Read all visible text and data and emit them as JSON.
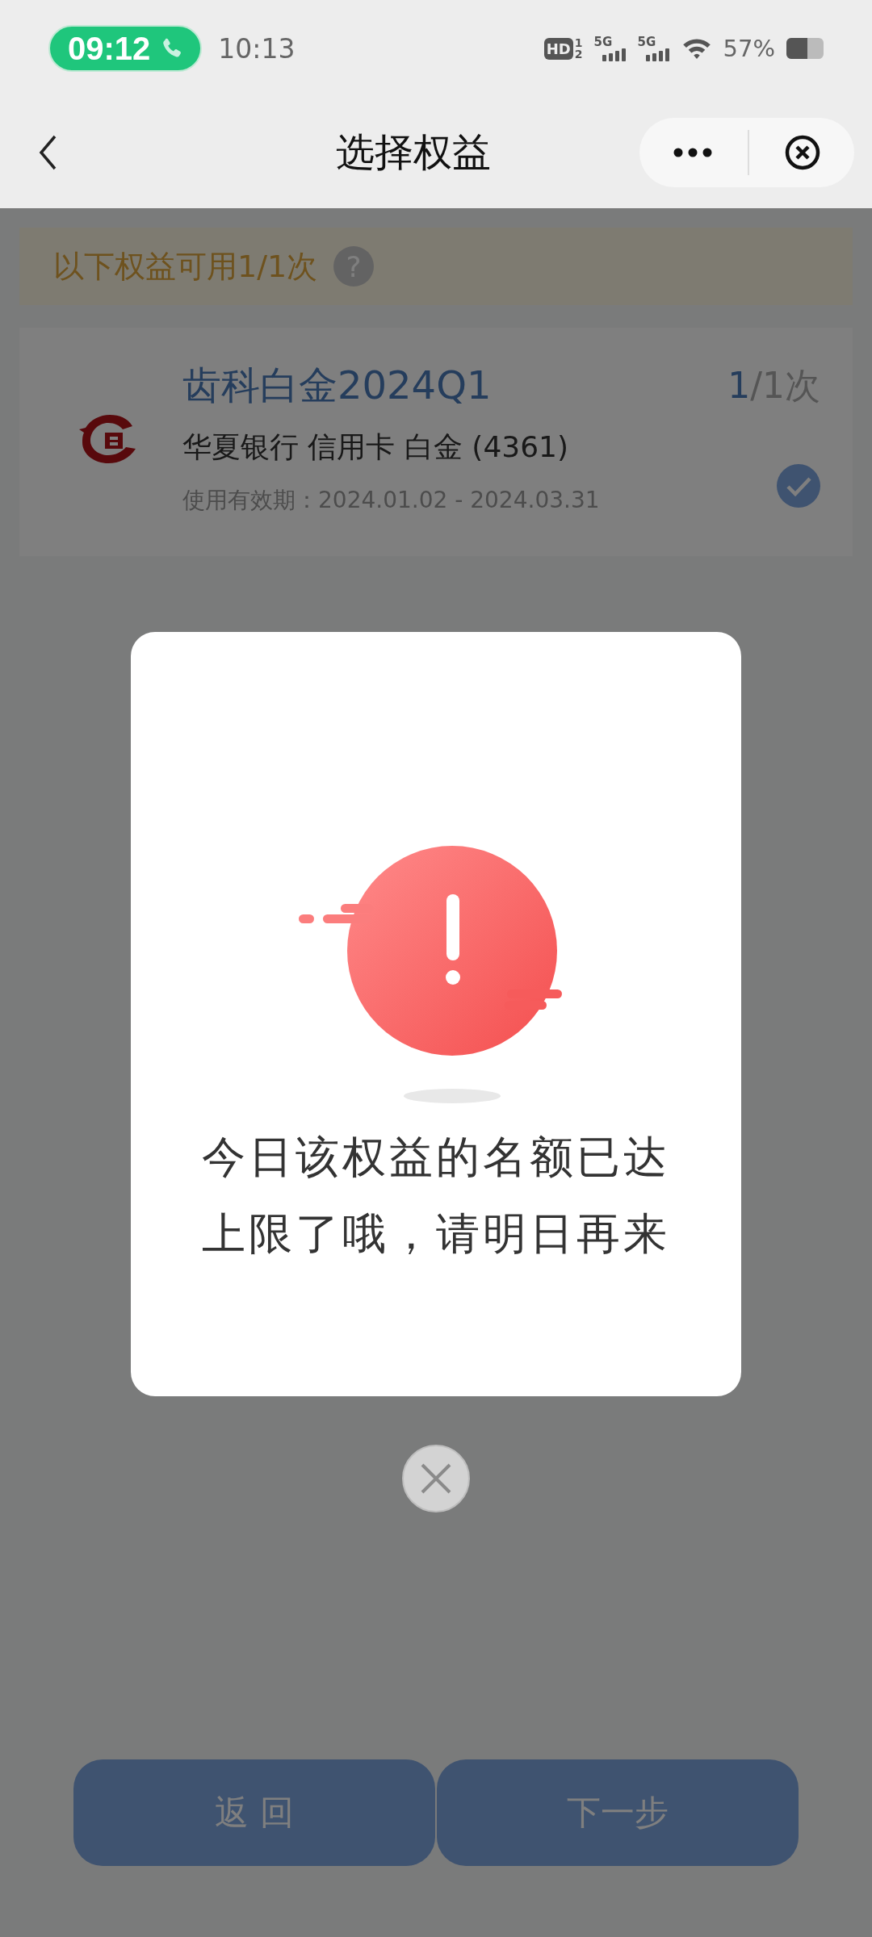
{
  "status_bar": {
    "call_time": "09:12",
    "time": "10:13",
    "hd": "HD",
    "hd_slots": [
      "1",
      "2"
    ],
    "networks": [
      {
        "label": "5G"
      },
      {
        "label": "5G"
      }
    ],
    "battery_text": "57%"
  },
  "nav": {
    "title": "选择权益"
  },
  "notice": {
    "text": "以下权益可用1/1次",
    "help": "?"
  },
  "benefit": {
    "title": "齿科白金2024Q1",
    "used": "1",
    "total": "/1次",
    "card": "华夏银行 信用卡 白金 (4361)",
    "validity": "使用有效期：2024.01.02 - 2024.03.31",
    "selected": true
  },
  "buttons": [
    {
      "label": "返 回"
    },
    {
      "label": "下一步"
    }
  ],
  "dialog": {
    "lines": [
      "今日该权益的名额已达",
      "上限了哦，请明日再来"
    ]
  }
}
